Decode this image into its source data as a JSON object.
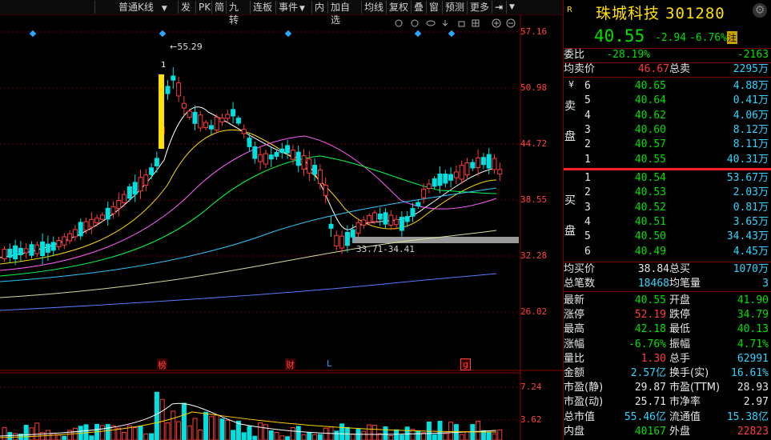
{
  "toolbar": {
    "chart_type": "普通K线",
    "items": [
      "发",
      "PK",
      "简",
      "九转",
      "连板",
      "事件",
      "内",
      "加自选",
      "均线",
      "复权",
      "叠",
      "窗",
      "预测",
      "更多"
    ]
  },
  "chart": {
    "price_axis": [
      "57.16",
      "50.98",
      "44.72",
      "38.55",
      "32.28",
      "26.02"
    ],
    "volume_axis": [
      "7.24",
      "3.62"
    ],
    "high_marker": "55.29",
    "high_marker_prefix": "1",
    "range_label": "33.71-34.41",
    "event_tags": [
      "榜",
      "财",
      "L",
      "g"
    ]
  },
  "quote": {
    "badge": "R",
    "name": "珠城科技",
    "code": "301280",
    "price": "40.55",
    "change": "-2.94",
    "change_pct": "-6.76%",
    "tag": "注",
    "webi_label": "委比",
    "webi": "-28.19%",
    "weicha": "-2163",
    "avg_sell_label": "均卖价",
    "avg_sell": "46.67",
    "total_sell_label": "总卖",
    "total_sell": "2295万",
    "sell_label": [
      "卖",
      "盘"
    ],
    "sell": [
      {
        "lvl": "6",
        "price": "40.65",
        "vol": "4.88万"
      },
      {
        "lvl": "5",
        "price": "40.64",
        "vol": "0.41万"
      },
      {
        "lvl": "4",
        "price": "40.62",
        "vol": "4.06万"
      },
      {
        "lvl": "3",
        "price": "40.60",
        "vol": "8.12万"
      },
      {
        "lvl": "2",
        "price": "40.57",
        "vol": "8.11万"
      },
      {
        "lvl": "1",
        "price": "40.55",
        "vol": "40.31万"
      }
    ],
    "buy_label": [
      "买",
      "盘"
    ],
    "buy": [
      {
        "lvl": "1",
        "price": "40.54",
        "vol": "53.67万"
      },
      {
        "lvl": "2",
        "price": "40.53",
        "vol": "2.03万"
      },
      {
        "lvl": "3",
        "price": "40.52",
        "vol": "0.81万"
      },
      {
        "lvl": "4",
        "price": "40.51",
        "vol": "3.65万"
      },
      {
        "lvl": "5",
        "price": "40.50",
        "vol": "34.43万"
      },
      {
        "lvl": "6",
        "price": "40.49",
        "vol": "4.45万"
      }
    ],
    "avg_buy_label": "均买价",
    "avg_buy": "38.84",
    "total_buy_label": "总买",
    "total_buy": "1070万",
    "deals_label": "总笔数",
    "deals": "18468",
    "avg_deal_label": "均笔量",
    "avg_deal": "3",
    "stats": [
      {
        "l1": "最新",
        "v1": "40.55",
        "c1": "green",
        "l2": "开盘",
        "v2": "41.90",
        "c2": "green"
      },
      {
        "l1": "涨停",
        "v1": "52.19",
        "c1": "red",
        "l2": "跌停",
        "v2": "34.79",
        "c2": "green"
      },
      {
        "l1": "最高",
        "v1": "42.18",
        "c1": "green",
        "l2": "最低",
        "v2": "40.13",
        "c2": "green"
      },
      {
        "l1": "涨幅",
        "v1": "-6.76%",
        "c1": "green",
        "l2": "振幅",
        "v2": "4.71%",
        "c2": "green"
      },
      {
        "l1": "量比",
        "v1": "1.30",
        "c1": "red",
        "l2": "总手",
        "v2": "62991",
        "c2": "cyan"
      },
      {
        "l1": "金额",
        "v1": "2.57亿",
        "c1": "cyan",
        "l2": "换手(实)",
        "v2": "16.61%",
        "c2": "cyan"
      },
      {
        "l1": "市盈(静)",
        "v1": "29.87",
        "c1": "white",
        "l2": "市盈(TTM)",
        "v2": "28.93",
        "c2": "white"
      },
      {
        "l1": "市盈(动)",
        "v1": "25.71",
        "c1": "white",
        "l2": "市净率",
        "v2": "2.97",
        "c2": "white"
      },
      {
        "l1": "总市值",
        "v1": "55.46亿",
        "c1": "cyan",
        "l2": "流通值",
        "v2": "15.38亿",
        "c2": "cyan"
      },
      {
        "l1": "内盘",
        "v1": "40167",
        "c1": "green",
        "l2": "外盘",
        "v2": "22823",
        "c2": "red"
      }
    ]
  },
  "colors": {
    "up": "#ff3b3b",
    "down": "#00e0e0",
    "limit": "#ffe000",
    "panel_border": "#7a0000"
  }
}
